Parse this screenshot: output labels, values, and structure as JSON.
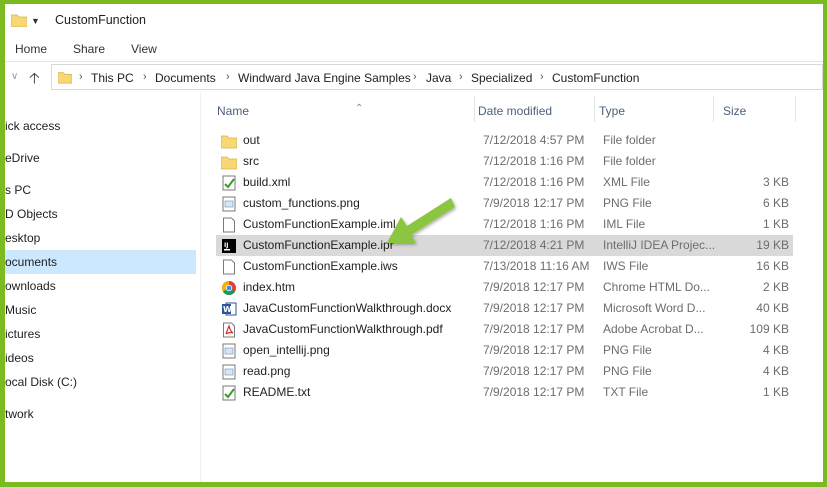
{
  "window": {
    "title": "CustomFunction"
  },
  "ribbon": {
    "tabs": [
      "Home",
      "Share",
      "View"
    ]
  },
  "address": {
    "crumbs": [
      "This PC",
      "Documents",
      "Windward Java Engine Samples",
      "Java",
      "Specialized",
      "CustomFunction"
    ]
  },
  "nav": {
    "items": [
      {
        "label": "ick access"
      },
      {
        "label": "eDrive"
      },
      {
        "label": "s PC"
      },
      {
        "label": "D Objects"
      },
      {
        "label": "esktop"
      },
      {
        "label": "ocuments"
      },
      {
        "label": "ownloads"
      },
      {
        "label": "Music"
      },
      {
        "label": "ictures"
      },
      {
        "label": "ideos"
      },
      {
        "label": "ocal Disk (C:)"
      },
      {
        "label": "twork"
      }
    ]
  },
  "columns": {
    "name": "Name",
    "date": "Date modified",
    "type": "Type",
    "size": "Size"
  },
  "files": [
    {
      "name": "out",
      "date": "7/12/2018 4:57 PM",
      "type": "File folder",
      "size": "",
      "icon": "folder-icon"
    },
    {
      "name": "src",
      "date": "7/12/2018 1:16 PM",
      "type": "File folder",
      "size": "",
      "icon": "folder-icon"
    },
    {
      "name": "build.xml",
      "date": "7/12/2018 1:16 PM",
      "type": "XML File",
      "size": "3 KB",
      "icon": "xml-file-icon"
    },
    {
      "name": "custom_functions.png",
      "date": "7/9/2018 12:17 PM",
      "type": "PNG File",
      "size": "6 KB",
      "icon": "image-file-icon"
    },
    {
      "name": "CustomFunctionExample.iml",
      "date": "7/12/2018 1:16 PM",
      "type": "IML File",
      "size": "1 KB",
      "icon": "blank-file-icon"
    },
    {
      "name": "CustomFunctionExample.ipr",
      "date": "7/12/2018 4:21 PM",
      "type": "IntelliJ IDEA Projec...",
      "size": "19 KB",
      "icon": "intellij-file-icon"
    },
    {
      "name": "CustomFunctionExample.iws",
      "date": "7/13/2018 11:16 AM",
      "type": "IWS File",
      "size": "16 KB",
      "icon": "blank-file-icon"
    },
    {
      "name": "index.htm",
      "date": "7/9/2018 12:17 PM",
      "type": "Chrome HTML Do...",
      "size": "2 KB",
      "icon": "chrome-icon"
    },
    {
      "name": "JavaCustomFunctionWalkthrough.docx",
      "date": "7/9/2018 12:17 PM",
      "type": "Microsoft Word D...",
      "size": "40 KB",
      "icon": "word-file-icon"
    },
    {
      "name": "JavaCustomFunctionWalkthrough.pdf",
      "date": "7/9/2018 12:17 PM",
      "type": "Adobe Acrobat D...",
      "size": "109 KB",
      "icon": "pdf-file-icon"
    },
    {
      "name": "open_intellij.png",
      "date": "7/9/2018 12:17 PM",
      "type": "PNG File",
      "size": "4 KB",
      "icon": "image-file-icon"
    },
    {
      "name": "read.png",
      "date": "7/9/2018 12:17 PM",
      "type": "PNG File",
      "size": "4 KB",
      "icon": "image-file-icon"
    },
    {
      "name": "README.txt",
      "date": "7/9/2018 12:17 PM",
      "type": "TXT File",
      "size": "1 KB",
      "icon": "text-file-icon"
    }
  ],
  "selected_file_index": 5,
  "colors": {
    "frame": "#7cbb1f",
    "arrow": "#8cc63f",
    "nav_selected": "#cce8ff",
    "row_selected": "#d9d9d9",
    "folder": "#f8d775"
  }
}
